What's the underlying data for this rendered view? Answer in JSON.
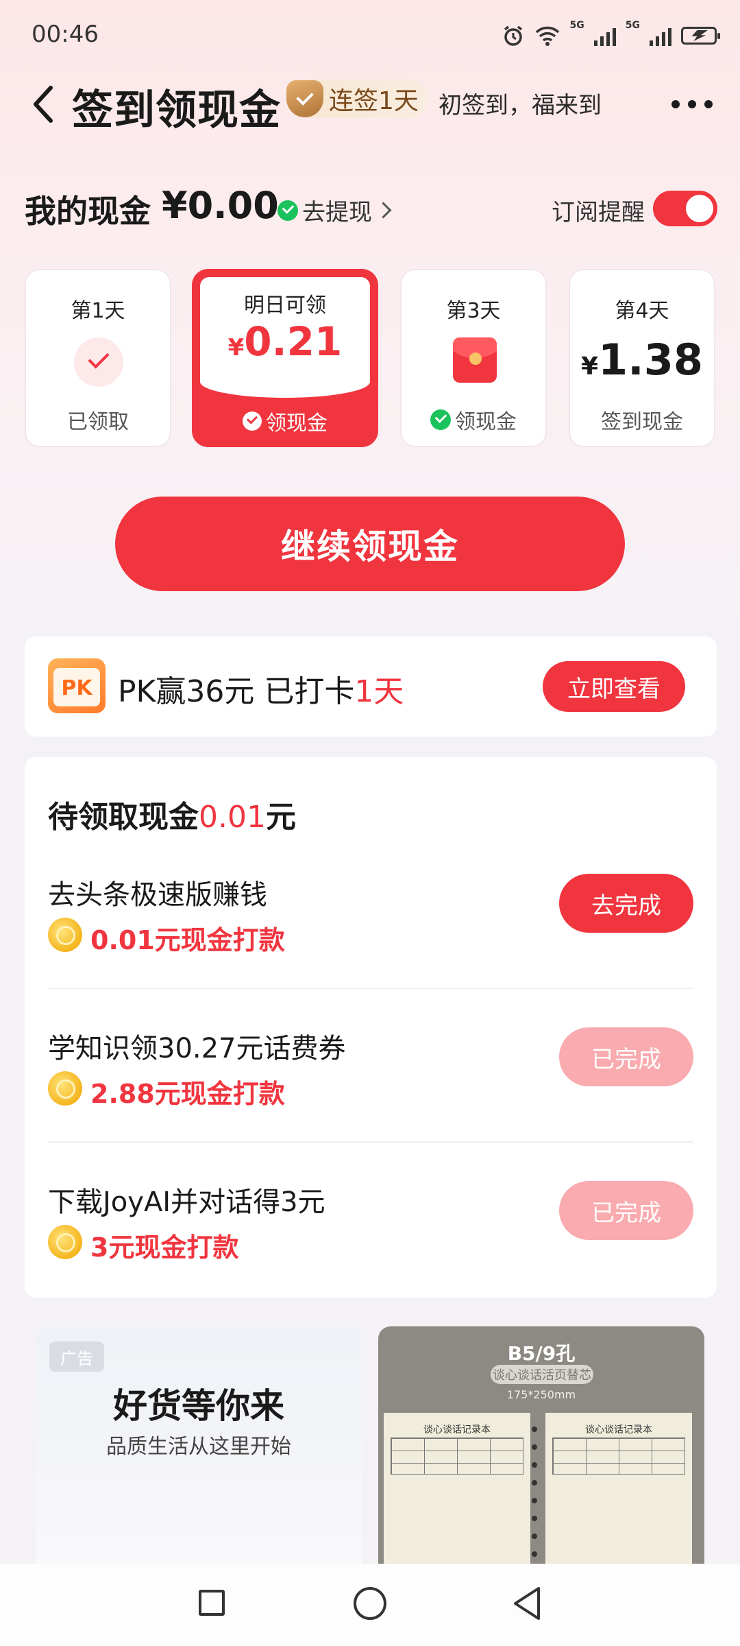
{
  "status_bar": {
    "time": "00:46",
    "net1": "5G",
    "net2": "5G"
  },
  "header": {
    "title": "签到领现金",
    "streak": "连签1天",
    "slogan": "初签到，福来到"
  },
  "cash": {
    "label": "我的现金",
    "value": "¥0.00",
    "withdraw": "去提现",
    "subscribe": "订阅提醒",
    "subscribe_on": true
  },
  "days": [
    {
      "label": "第1天",
      "status": "已领取"
    },
    {
      "label": "明日可领",
      "currency": "¥",
      "amount": "0.21",
      "action": "领现金"
    },
    {
      "label": "第3天",
      "action": "领现金"
    },
    {
      "label": "第4天",
      "currency": "¥",
      "amount": "1.38",
      "status": "签到现金"
    }
  ],
  "main_button": "继续领现金",
  "pk": {
    "icon": "PK",
    "text": "PK赢36元 已打卡",
    "days": "1天",
    "button": "立即查看"
  },
  "tasks": {
    "title": "待领取现金",
    "amount": "0.01",
    "unit": "元",
    "items": [
      {
        "name": "去头条极速版赚钱",
        "reward": "0.01元现金打款",
        "button": "去完成",
        "done": false
      },
      {
        "name": "学知识领30.27元话费券",
        "reward": "2.88元现金打款",
        "button": "已完成",
        "done": true
      },
      {
        "name": "下载JoyAI并对话得3元",
        "reward": "3元现金打款",
        "button": "已完成",
        "done": true
      }
    ]
  },
  "ads": {
    "left": {
      "tag": "广告",
      "headline": "好货等你来",
      "sub": "品质生活从这里开始"
    },
    "right": {
      "title": "B5/9孔",
      "pill": "谈心谈话活页替芯",
      "size": "175*250mm",
      "page_title": "谈心谈话记录本"
    }
  },
  "colors": {
    "accent": "#f0353f",
    "done_button": "#f9abaf",
    "green_check": "#19c25a"
  },
  "icons": [
    "back-arrow-icon",
    "more-icon",
    "green-check-icon",
    "red-envelope-icon",
    "coin-icon",
    "nav-square-icon",
    "nav-circle-icon",
    "nav-back-icon"
  ]
}
